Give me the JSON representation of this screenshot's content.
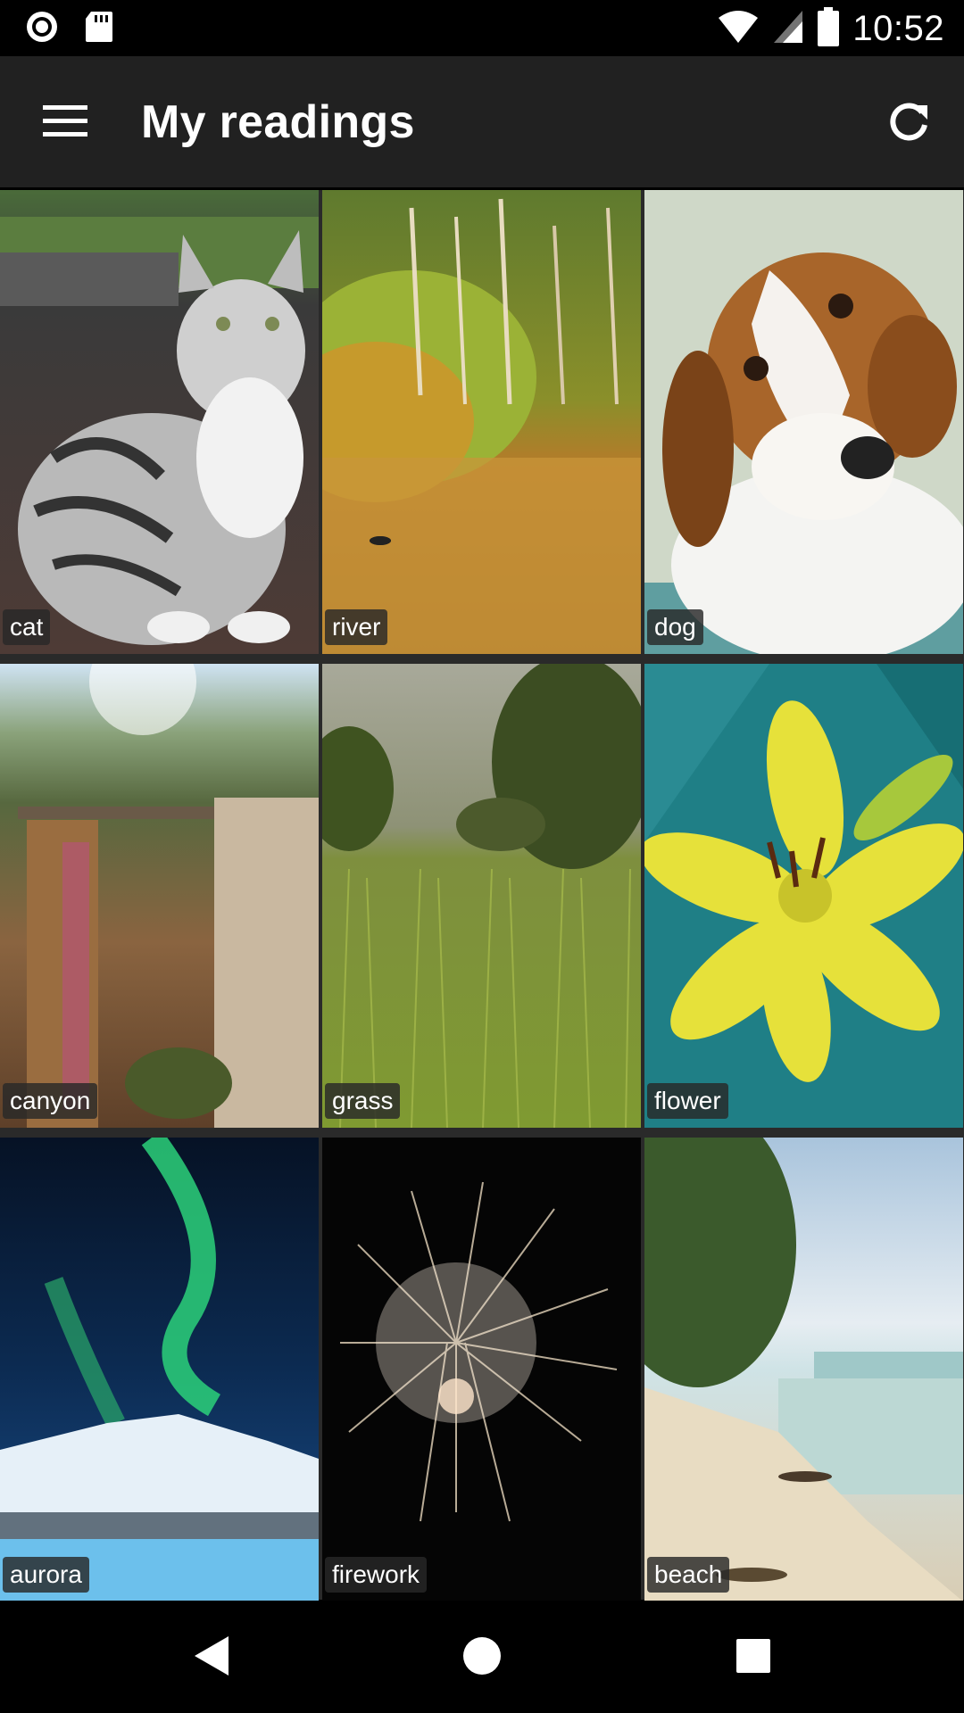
{
  "status_bar": {
    "time": "10:52",
    "icons": [
      "record-icon",
      "sd-card-icon",
      "wifi-icon",
      "signal-icon",
      "battery-icon"
    ]
  },
  "app_bar": {
    "title": "My readings",
    "menu_icon": "menu-icon",
    "refresh_icon": "refresh-icon"
  },
  "gallery": {
    "items": [
      {
        "label": "cat"
      },
      {
        "label": "river"
      },
      {
        "label": "dog"
      },
      {
        "label": "canyon"
      },
      {
        "label": "grass"
      },
      {
        "label": "flower"
      },
      {
        "label": "aurora"
      },
      {
        "label": "firework"
      },
      {
        "label": "beach"
      }
    ]
  },
  "nav_bar": {
    "icons": [
      "back-icon",
      "home-icon",
      "recents-icon"
    ]
  }
}
